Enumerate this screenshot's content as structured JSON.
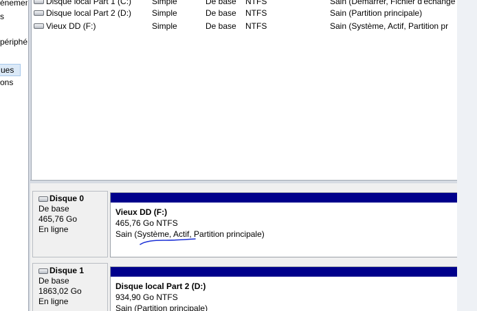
{
  "nav": {
    "items": [
      "énement",
      "s",
      "périphé",
      "ues",
      "ons"
    ]
  },
  "volumes": [
    {
      "name": "Disque local Part 1 (C:)",
      "layout": "Simple",
      "type": "De base",
      "fs": "NTFS",
      "status": "Sain (Démarrer, Fichier d'échange"
    },
    {
      "name": "Disque local Part 2 (D:)",
      "layout": "Simple",
      "type": "De base",
      "fs": "NTFS",
      "status": "Sain (Partition principale)"
    },
    {
      "name": "Vieux DD (F:)",
      "layout": "Simple",
      "type": "De base",
      "fs": "NTFS",
      "status": "Sain (Système, Actif, Partition pr"
    }
  ],
  "disks": [
    {
      "name": "Disque 0",
      "type": "De base",
      "size": "465,76 Go",
      "state": "En ligne",
      "partition": {
        "title": "Vieux DD  (F:)",
        "detail": "465,76 Go NTFS",
        "status": "Sain (Système, Actif, Partition principale)"
      }
    },
    {
      "name": "Disque 1",
      "type": "De base",
      "size": "1863,02 Go",
      "state": "En ligne",
      "partition": {
        "title": "Disque local Part 2  (D:)",
        "detail": "934,90 Go NTFS",
        "status": "Sain (Partition principale)"
      }
    }
  ],
  "colors": {
    "partition_bar": "#00008b",
    "annotation": "#1a2fd6"
  }
}
